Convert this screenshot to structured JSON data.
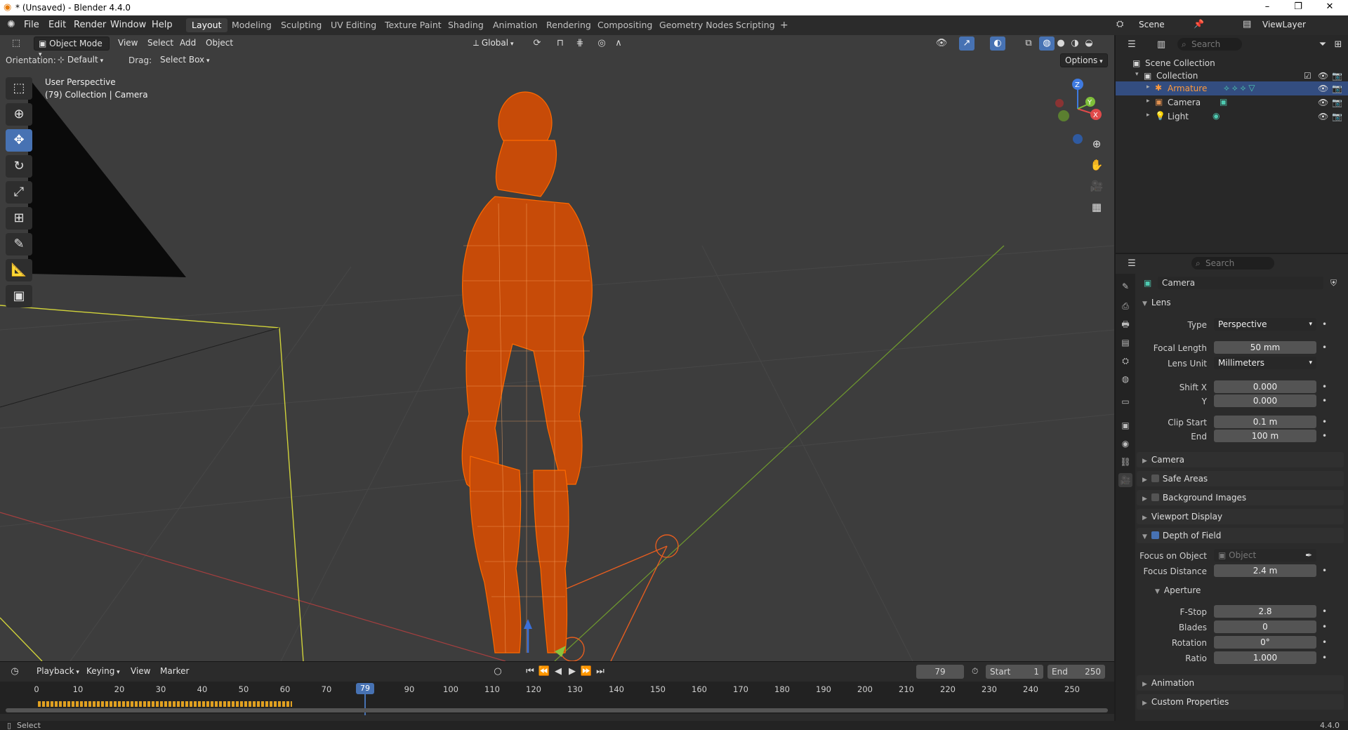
{
  "window": {
    "title": "* (Unsaved) - Blender 4.4.0",
    "min": "–",
    "max": "❐",
    "close": "✕"
  },
  "menu": {
    "items": [
      "File",
      "Edit",
      "Render",
      "Window",
      "Help"
    ]
  },
  "workspaces": {
    "tabs": [
      "Layout",
      "Modeling",
      "Sculpting",
      "UV Editing",
      "Texture Paint",
      "Shading",
      "Animation",
      "Rendering",
      "Compositing",
      "Geometry Nodes",
      "Scripting"
    ],
    "active": "Layout",
    "add": "+"
  },
  "scene": {
    "label": "Scene",
    "viewlayer": "ViewLayer"
  },
  "viewport_header": {
    "mode": "Object Mode",
    "menus": [
      "View",
      "Select",
      "Add",
      "Object"
    ],
    "transform_orientation": "Global",
    "options": "Options"
  },
  "tool_settings": {
    "orientation_label": "Orientation:",
    "orientation_value": "Default",
    "drag_label": "Drag:",
    "drag_value": "Select Box"
  },
  "viewport_overlay": {
    "perspective": "User Perspective",
    "collection": "(79) Collection | Camera"
  },
  "gizmo": {
    "z": "Z",
    "x": "X",
    "y": "Y"
  },
  "timeline": {
    "menus": [
      "Playback",
      "Keying",
      "View",
      "Marker"
    ],
    "current_frame": "79",
    "start_label": "Start",
    "start": "1",
    "end_label": "End",
    "end": "250",
    "ticks": [
      "0",
      "10",
      "20",
      "30",
      "40",
      "50",
      "60",
      "70",
      "90",
      "100",
      "110",
      "120",
      "130",
      "140",
      "150",
      "160",
      "170",
      "180",
      "190",
      "200",
      "210",
      "220",
      "230",
      "240",
      "250"
    ]
  },
  "status": {
    "left": "Select",
    "version": "4.4.0"
  },
  "outliner": {
    "search_placeholder": "Search",
    "scene_collection": "Scene Collection",
    "collection": "Collection",
    "objects": [
      "Armature",
      "Camera",
      "Light"
    ]
  },
  "properties": {
    "search_placeholder": "Search",
    "object_name": "Camera",
    "lens": {
      "header": "Lens",
      "type_label": "Type",
      "type": "Perspective",
      "focal_label": "Focal Length",
      "focal": "50 mm",
      "unit_label": "Lens Unit",
      "unit": "Millimeters",
      "shiftx_label": "Shift X",
      "shiftx": "0.000",
      "shifty_label": "Y",
      "shifty": "0.000",
      "clipstart_label": "Clip Start",
      "clipstart": "0.1 m",
      "clipend_label": "End",
      "clipend": "100 m"
    },
    "sections": [
      "Camera",
      "Safe Areas",
      "Background Images",
      "Viewport Display"
    ],
    "dof": {
      "header": "Depth of Field",
      "focus_obj_label": "Focus on Object",
      "focus_obj_placeholder": "Object",
      "focus_dist_label": "Focus Distance",
      "focus_dist": "2.4 m",
      "aperture_header": "Aperture",
      "fstop_label": "F-Stop",
      "fstop": "2.8",
      "blades_label": "Blades",
      "blades": "0",
      "rotation_label": "Rotation",
      "rotation": "0°",
      "ratio_label": "Ratio",
      "ratio": "1.000"
    },
    "footer_sections": [
      "Animation",
      "Custom Properties"
    ]
  },
  "colors": {
    "accent": "#4772b3",
    "selected_orange": "#ff6a00",
    "viewport_bg": "#3d3d3d",
    "panel_bg": "#2b2b2b"
  }
}
